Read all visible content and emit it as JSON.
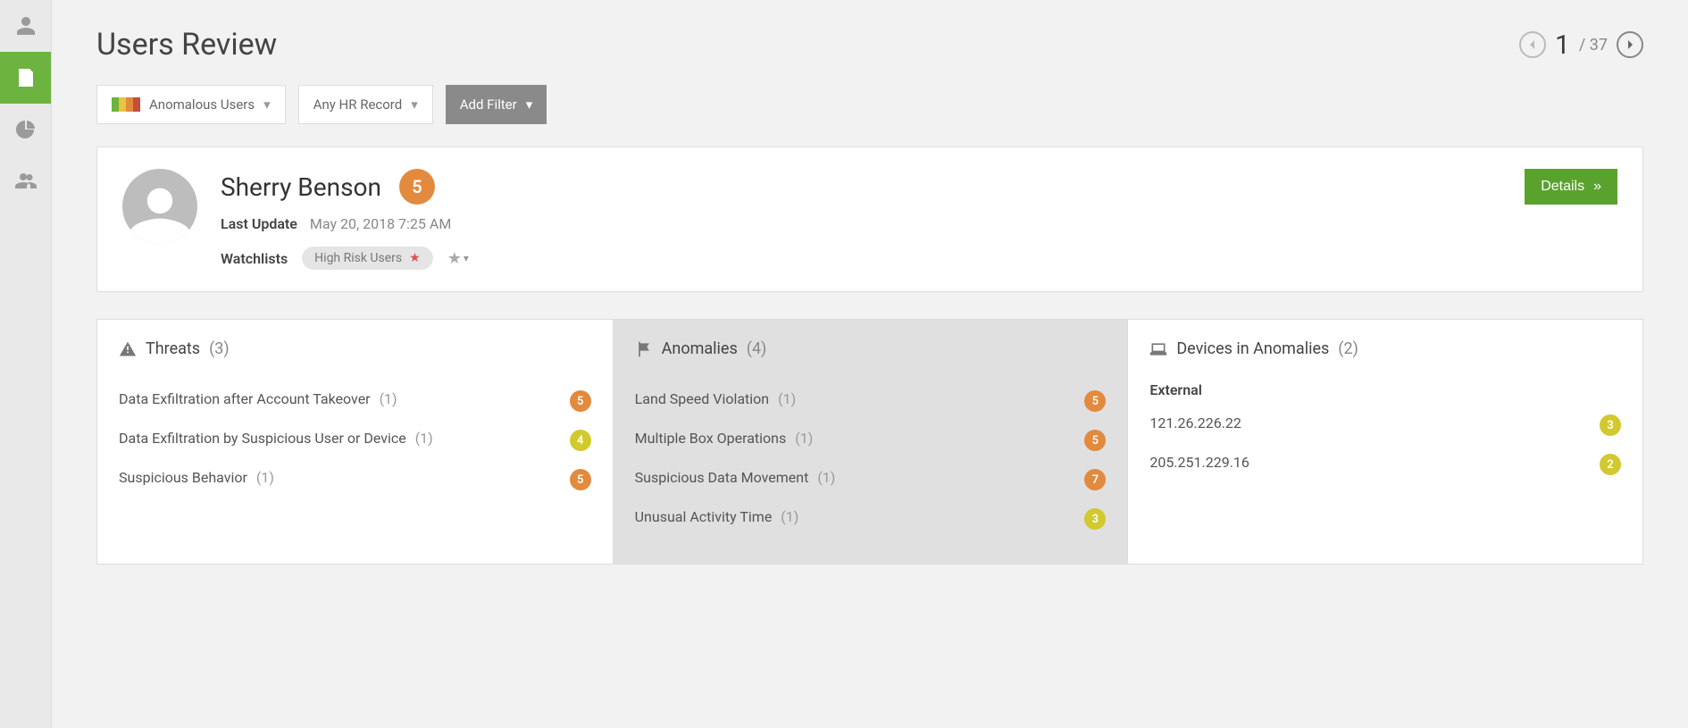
{
  "sidebar": {
    "items": [
      "users",
      "review",
      "analytics",
      "groups"
    ],
    "active": 1
  },
  "header": {
    "title": "Users Review",
    "pager": {
      "current": "1",
      "total": "37",
      "sep": "/"
    }
  },
  "filters": {
    "anomalous": "Anomalous Users",
    "hr": "Any HR Record",
    "add": "Add Filter"
  },
  "user": {
    "name": "Sherry Benson",
    "score": "5",
    "lastUpdateLabel": "Last Update",
    "lastUpdateValue": "May 20, 2018 7:25 AM",
    "watchlistsLabel": "Watchlists",
    "watchlistPill": "High Risk Users",
    "detailsLabel": "Details"
  },
  "threats": {
    "title": "Threats",
    "count": "(3)",
    "items": [
      {
        "label": "Data Exfiltration after Account Takeover",
        "n": "(1)",
        "score": "5",
        "cls": "score-orange"
      },
      {
        "label": "Data Exfiltration by Suspicious User or Device",
        "n": "(1)",
        "score": "4",
        "cls": "score-yellow"
      },
      {
        "label": "Suspicious Behavior",
        "n": "(1)",
        "score": "5",
        "cls": "score-orange"
      }
    ]
  },
  "anomalies": {
    "title": "Anomalies",
    "count": "(4)",
    "items": [
      {
        "label": "Land Speed Violation",
        "n": "(1)",
        "score": "5",
        "cls": "score-orange"
      },
      {
        "label": "Multiple Box Operations",
        "n": "(1)",
        "score": "5",
        "cls": "score-orange"
      },
      {
        "label": "Suspicious Data Movement",
        "n": "(1)",
        "score": "7",
        "cls": "score-orange"
      },
      {
        "label": "Unusual Activity Time",
        "n": "(1)",
        "score": "3",
        "cls": "score-yellow"
      }
    ]
  },
  "devices": {
    "title": "Devices in Anomalies",
    "count": "(2)",
    "subhead": "External",
    "items": [
      {
        "label": "121.26.226.22",
        "score": "3",
        "cls": "score-yellow"
      },
      {
        "label": "205.251.229.16",
        "score": "2",
        "cls": "score-yellow"
      }
    ]
  }
}
